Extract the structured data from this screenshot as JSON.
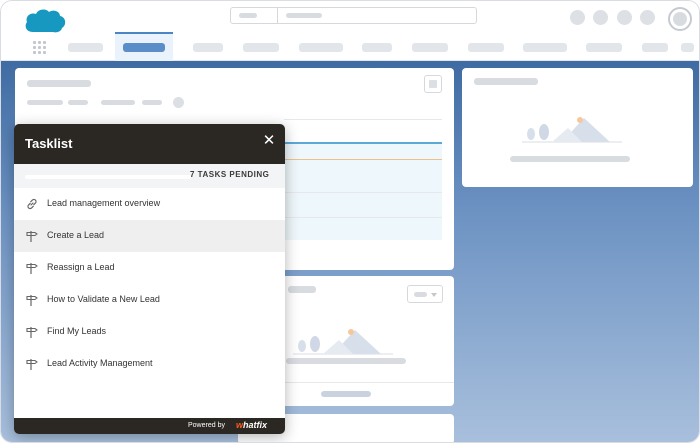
{
  "tasklist": {
    "title": "Tasklist",
    "close_icon": "close-icon",
    "progress_fraction": 0.0,
    "pending_text": "7 TASKS PENDING",
    "items": [
      {
        "label": "Lead management overview",
        "icon": "link-icon"
      },
      {
        "label": "Create a Lead",
        "icon": "signpost-icon"
      },
      {
        "label": "Reassign a Lead",
        "icon": "signpost-icon"
      },
      {
        "label": "How to Validate a New Lead",
        "icon": "signpost-icon"
      },
      {
        "label": "Find My Leads",
        "icon": "signpost-icon"
      },
      {
        "label": "Lead Activity Management",
        "icon": "signpost-icon"
      }
    ],
    "active_index": 1,
    "footer": {
      "powered_by": "Powered by",
      "brand_w": "w",
      "brand_rest": "hatfix"
    }
  },
  "colors": {
    "tasklist_header": "#2b2823",
    "brand_accent": "#ff5a1f",
    "nav_active": "#5b8ec8",
    "background_gradient_top": "#3f6ba3"
  }
}
